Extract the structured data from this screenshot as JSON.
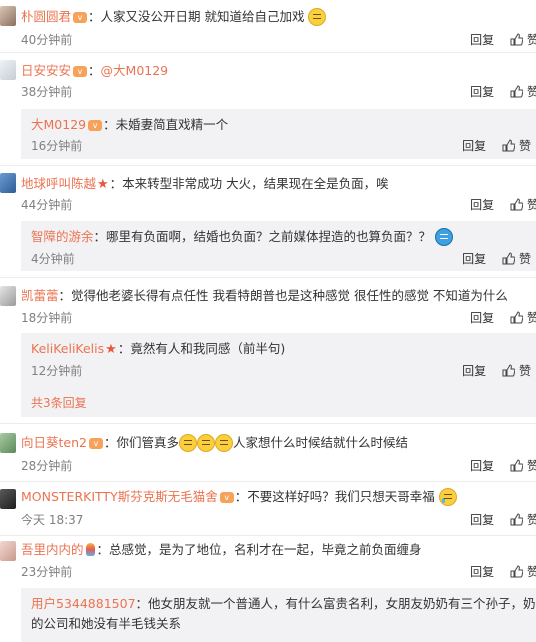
{
  "labels": {
    "reply": "回复",
    "like": "赞"
  },
  "comments": [
    {
      "user": "朴圆圆君",
      "text": "：人家又没公开日期 就知道给自己加戏",
      "time": "40分钟前"
    },
    {
      "user": "日安安安",
      "mention": "@大M0129",
      "time": "38分钟前",
      "subs": [
        {
          "user": "大M0129",
          "text": "：未婚妻简直戏精一个",
          "time": "16分钟前"
        }
      ]
    },
    {
      "user": "地球呼叫陈越",
      "text": "：本来转型非常成功 大火，结果现在全是负面，唉",
      "time": "44分钟前",
      "subs": [
        {
          "user": "智障的游余",
          "text": "：哪里有负面啊，结婚也负面？之前媒体捏造的也算负面？？",
          "time": "4分钟前"
        }
      ]
    },
    {
      "user": "凯蕾蕾",
      "text": "：觉得他老婆长得有点任性 我看特朗普也是这种感觉 很任性的感觉 不知道为什么",
      "time": "18分钟前",
      "subs": [
        {
          "user": "KeliKeliKelis",
          "text": "：竟然有人和我同感（前半句)",
          "time": "12分钟前"
        }
      ],
      "more": "共3条回复"
    },
    {
      "user": "向日葵ten2",
      "text": "：你们管真多",
      "text2": "人家想什么时候结就什么时候结",
      "time": "28分钟前"
    },
    {
      "user": "MONSTERKITTY斯芬克斯无毛猫舍",
      "text": "：不要这样好吗？我们只想天哥幸福",
      "time": "今天 18:37"
    },
    {
      "user": "吾里内内的",
      "text": "：总感觉，是为了地位，名利才在一起，毕竟之前负面缠身",
      "time": "23分钟前",
      "subs": [
        {
          "user": "用户5344881507",
          "text": "：他女朋友就一个普通人，有什么富贵名利，女朋友奶奶有三个孙子，奶奶",
          "text2": "的公司和她没有半毛钱关系"
        }
      ]
    }
  ]
}
